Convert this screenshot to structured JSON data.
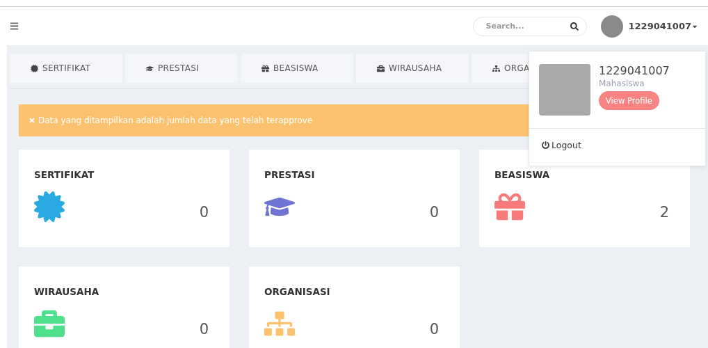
{
  "header": {
    "search": {
      "placeholder": "Search..."
    },
    "user": "1229041007"
  },
  "tabs": [
    {
      "label": "SERTIFIKAT",
      "kind": "certificate"
    },
    {
      "label": "PRESTASI",
      "kind": "cap"
    },
    {
      "label": "BEASISWA",
      "kind": "gift"
    },
    {
      "label": "WIRAUSAHA",
      "kind": "briefcase"
    },
    {
      "label": "ORGA",
      "kind": "sitemap"
    }
  ],
  "alert": "Data yang ditampilkan adalah jumlah data yang telah terapprove",
  "cards": [
    {
      "title": "SERTIFIKAT",
      "kind": "certificate",
      "color": "#29a9e1",
      "count": "0"
    },
    {
      "title": "PRESTASI",
      "kind": "cap",
      "color": "#6f74d4",
      "count": "0"
    },
    {
      "title": "BEASISWA",
      "kind": "gift",
      "color": "#f97a7a",
      "count": "2"
    },
    {
      "title": "WIRAUSAHA",
      "kind": "briefcase",
      "color": "#4fe08c",
      "count": "0"
    },
    {
      "title": "ORGANISASI",
      "kind": "sitemap",
      "color": "#fcc26f",
      "count": "0"
    }
  ],
  "dropdown": {
    "name": "1229041007",
    "role": "Mahasiswa",
    "button": "View Profile",
    "logout": "Logout"
  }
}
